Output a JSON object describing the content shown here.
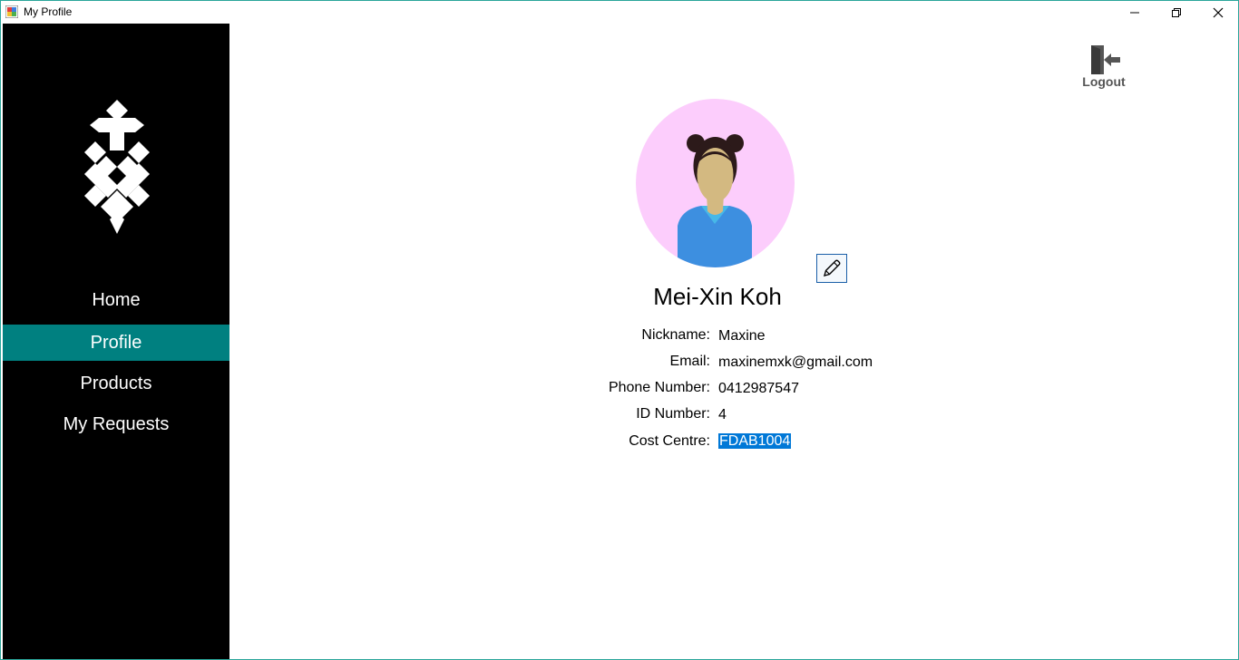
{
  "window": {
    "title": "My Profile"
  },
  "sidebar": {
    "items": [
      {
        "label": "Home",
        "active": false
      },
      {
        "label": "Profile",
        "active": true
      },
      {
        "label": "Products",
        "active": false
      },
      {
        "label": "My Requests",
        "active": false
      }
    ],
    "accent_color": "#008080"
  },
  "header": {
    "logout_label": "Logout"
  },
  "profile": {
    "name": "Mei-Xin Koh",
    "fields": [
      {
        "label": "Nickname:",
        "value": "Maxine"
      },
      {
        "label": "Email:",
        "value": "maxinemxk@gmail.com"
      },
      {
        "label": "Phone Number:",
        "value": "0412987547"
      },
      {
        "label": "ID Number:",
        "value": "4"
      },
      {
        "label": "Cost Centre:",
        "value": "FDAB1004"
      }
    ],
    "avatar_bg_color": "#fccdfc",
    "edit_icon": "pencil-icon"
  }
}
